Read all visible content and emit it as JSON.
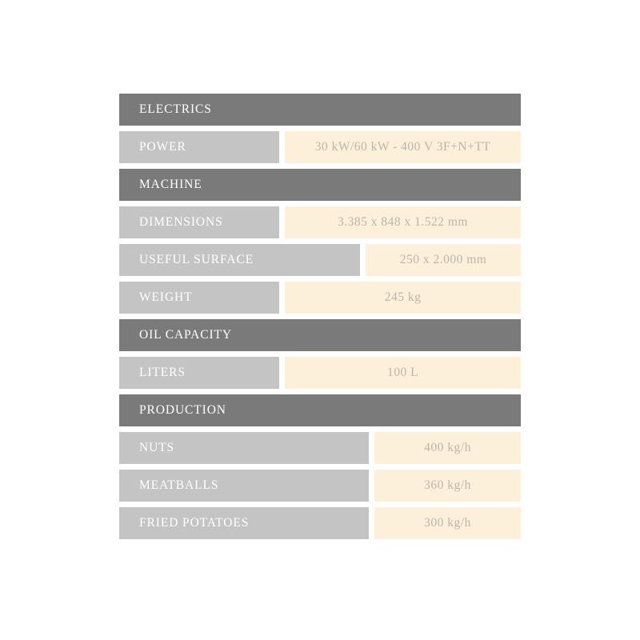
{
  "table": {
    "sections": [
      {
        "header": "ELECTRICS",
        "rows": [
          {
            "label": "POWER",
            "value": "30 kW/60 kW - 400 V 3F+N+TT",
            "width": "narrow"
          }
        ]
      },
      {
        "header": "MACHINE",
        "rows": [
          {
            "label": "DIMENSIONS",
            "value": "3.385 x 848 x 1.522 mm",
            "width": "narrow"
          },
          {
            "label": "USEFUL SURFACE",
            "value": "250 x 2.000 mm",
            "width": "medium"
          },
          {
            "label": "WEIGHT",
            "value": "245 kg",
            "width": "narrow"
          }
        ]
      },
      {
        "header": "OIL CAPACITY",
        "rows": [
          {
            "label": "LITERS",
            "value": "100 L",
            "width": "narrow"
          }
        ]
      },
      {
        "header": "PRODUCTION",
        "rows": [
          {
            "label": "NUTS",
            "value": "400 kg/h",
            "width": "wide"
          },
          {
            "label": "MEATBALLS",
            "value": "360 kg/h",
            "width": "wide"
          },
          {
            "label": "FRIED POTATOES",
            "value": "300 kg/h",
            "width": "wide"
          }
        ]
      }
    ]
  },
  "colors": {
    "header_background": "#7a7a7a",
    "label_background": "#c4c4c4",
    "value_background": "#fdf0da",
    "header_text": "#ffffff",
    "label_text": "#ffffff",
    "value_text": "#bab5ab",
    "page_background": "#ffffff"
  }
}
